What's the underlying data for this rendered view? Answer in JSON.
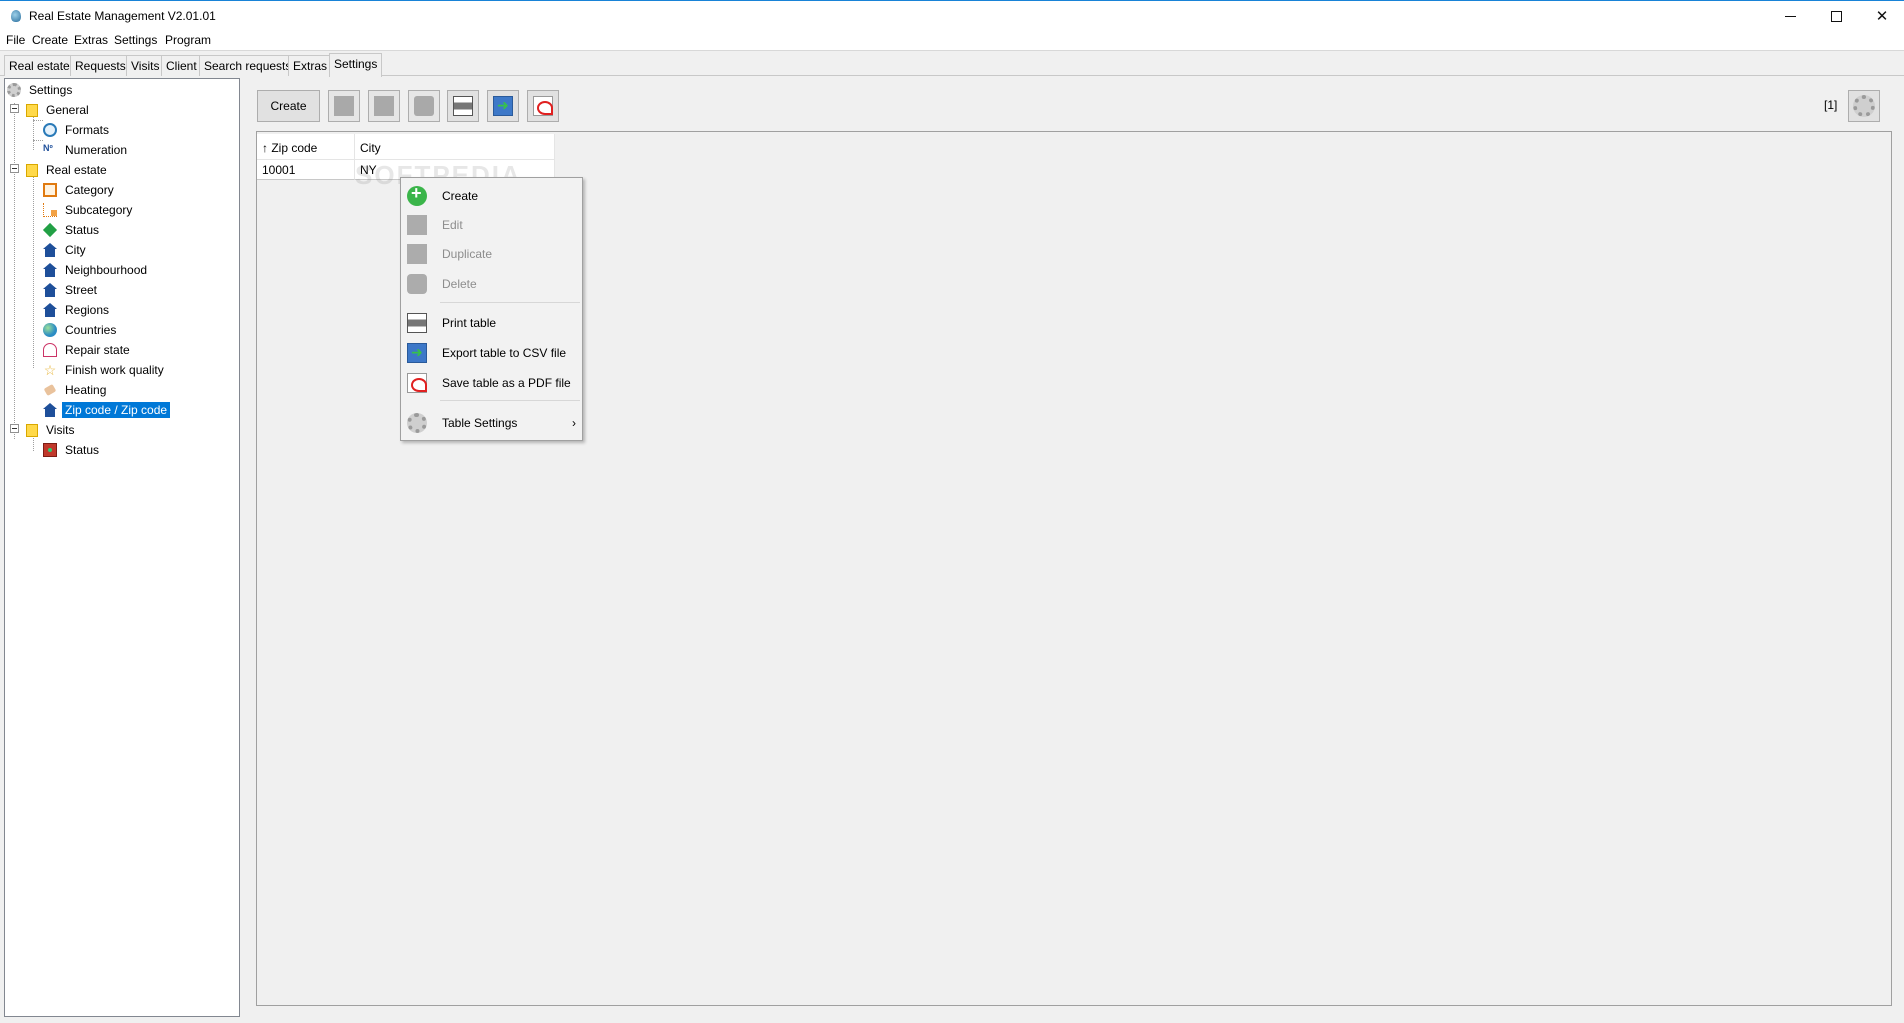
{
  "window": {
    "title": "Real Estate Management V2.01.01"
  },
  "menubar": {
    "items": [
      "File",
      "Create",
      "Extras",
      "Settings",
      "Program"
    ]
  },
  "tabs": [
    "Real estate",
    "Requests",
    "Visits",
    "Client",
    "Search requests",
    "Extras",
    "Settings"
  ],
  "active_tab": "Settings",
  "tree": {
    "root": "Settings",
    "groups": [
      {
        "label": "General",
        "children": [
          "Formats",
          "Numeration"
        ]
      },
      {
        "label": "Real estate",
        "children": [
          "Category",
          "Subcategory",
          "Status",
          "City",
          "Neighbourhood",
          "Street",
          "Regions",
          "Countries",
          "Repair state",
          "Finish work quality",
          "Heating",
          "Zip code / Zip code"
        ]
      },
      {
        "label": "Visits",
        "children": [
          "Status"
        ]
      }
    ],
    "numeration_glyph": "Nº",
    "selected": "Zip code / Zip code"
  },
  "toolbar": {
    "create_label": "Create",
    "page_indicator": "[1]",
    "icons": [
      "edit-icon",
      "duplicate-icon",
      "delete-icon",
      "print-icon",
      "export-csv-icon",
      "pdf-icon",
      "table-settings-icon"
    ]
  },
  "table": {
    "columns": [
      "↑ Zip code",
      "City"
    ],
    "rows": [
      [
        "10001",
        "NY"
      ]
    ]
  },
  "context_menu": {
    "items": [
      {
        "label": "Create",
        "enabled": true,
        "icon": "add-icon"
      },
      {
        "label": "Edit",
        "enabled": false,
        "icon": "edit-icon"
      },
      {
        "label": "Duplicate",
        "enabled": false,
        "icon": "duplicate-icon"
      },
      {
        "label": "Delete",
        "enabled": false,
        "icon": "delete-icon"
      },
      {
        "label": "Print table",
        "enabled": true,
        "icon": "print-icon"
      },
      {
        "label": "Export table to CSV file",
        "enabled": true,
        "icon": "export-csv-icon"
      },
      {
        "label": "Save table as a PDF file",
        "enabled": true,
        "icon": "pdf-icon"
      },
      {
        "label": "Table Settings",
        "enabled": true,
        "icon": "gear-icon",
        "submenu_arrow": "›"
      }
    ]
  },
  "watermark": "SOFTPEDIA",
  "colors": {
    "selection": "#0078d7",
    "title_accent": "#1883d7",
    "folder": "#ffd94a",
    "window_bg": "#f0f0f0"
  }
}
